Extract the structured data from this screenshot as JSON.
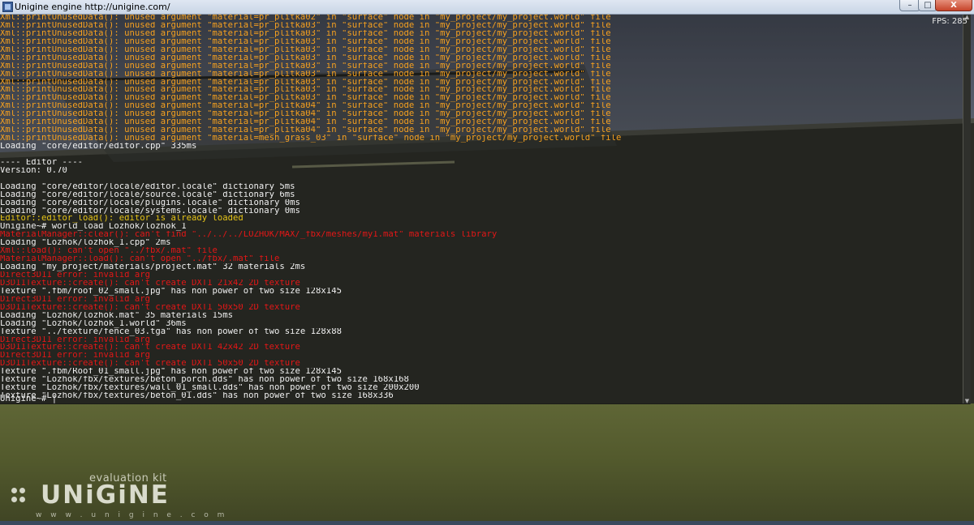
{
  "window": {
    "title": "Unigine engine http://unigine.com/",
    "minimize_label": "–",
    "maximize_label": "□",
    "close_label": "X",
    "fps_label": "FPS: 285"
  },
  "console": {
    "lines": [
      {
        "text": "Xml::printUnusedData(): unused argument \"material=pr_plitka02\" in \"surface\" node in \"my_project/my_project.world\" file",
        "color": "orange"
      },
      {
        "text": "Xml::printUnusedData(): unused argument \"material=pr_plitka03\" in \"surface\" node in \"my_project/my_project.world\" file",
        "color": "orange"
      },
      {
        "text": "Xml::printUnusedData(): unused argument \"material=pr_plitka03\" in \"surface\" node in \"my_project/my_project.world\" file",
        "color": "orange"
      },
      {
        "text": "Xml::printUnusedData(): unused argument \"material=pr_plitka03\" in \"surface\" node in \"my_project/my_project.world\" file",
        "color": "orange"
      },
      {
        "text": "Xml::printUnusedData(): unused argument \"material=pr_plitka03\" in \"surface\" node in \"my_project/my_project.world\" file",
        "color": "orange"
      },
      {
        "text": "Xml::printUnusedData(): unused argument \"material=pr_plitka03\" in \"surface\" node in \"my_project/my_project.world\" file",
        "color": "orange"
      },
      {
        "text": "Xml::printUnusedData(): unused argument \"material=pr_plitka03\" in \"surface\" node in \"my_project/my_project.world\" file",
        "color": "orange"
      },
      {
        "text": "Xml::printUnusedData(): unused argument \"material=pr_plitka03\" in \"surface\" node in \"my_project/my_project.world\" file",
        "color": "orange"
      },
      {
        "text": "Xml::printUnusedData(): unused argument \"material=pr_plitka03\" in \"surface\" node in \"my_project/my_project.world\" file",
        "color": "orange"
      },
      {
        "text": "Xml::printUnusedData(): unused argument \"material=pr_plitka03\" in \"surface\" node in \"my_project/my_project.world\" file",
        "color": "orange"
      },
      {
        "text": "Xml::printUnusedData(): unused argument \"material=pr_plitka03\" in \"surface\" node in \"my_project/my_project.world\" file",
        "color": "orange"
      },
      {
        "text": "Xml::printUnusedData(): unused argument \"material=pr_plitka04\" in \"surface\" node in \"my_project/my_project.world\" file",
        "color": "orange"
      },
      {
        "text": "Xml::printUnusedData(): unused argument \"material=pr_plitka04\" in \"surface\" node in \"my_project/my_project.world\" file",
        "color": "orange"
      },
      {
        "text": "Xml::printUnusedData(): unused argument \"material=pr_plitka04\" in \"surface\" node in \"my_project/my_project.world\" file",
        "color": "orange"
      },
      {
        "text": "Xml::printUnusedData(): unused argument \"material=pr_plitka04\" in \"surface\" node in \"my_project/my_project.world\" file",
        "color": "orange"
      },
      {
        "text": "Xml::printUnusedData(): unused argument \"material=mesh_grass_03\" in \"surface\" node in \"my_project/my_project.world\" file",
        "color": "orange"
      },
      {
        "text": "Loading \"core/editor/editor.cpp\" 335ms",
        "color": "white"
      },
      {
        "text": "",
        "color": "white"
      },
      {
        "text": "---- Editor ----",
        "color": "white"
      },
      {
        "text": "Version: 0.70",
        "color": "white"
      },
      {
        "text": "",
        "color": "white"
      },
      {
        "text": "Loading \"core/editor/locale/editor.locale\" dictionary 5ms",
        "color": "white"
      },
      {
        "text": "Loading \"core/editor/locale/source.locale\" dictionary 6ms",
        "color": "white"
      },
      {
        "text": "Loading \"core/editor/locale/plugins.locale\" dictionary 0ms",
        "color": "white"
      },
      {
        "text": "Loading \"core/editor/locale/systems.locale\" dictionary 0ms",
        "color": "white"
      },
      {
        "text": "Editor::editor_load(): editor is already loaded",
        "color": "yellow"
      },
      {
        "text": "Unigine~# world_load Lozhok/lozhok_1",
        "color": "white"
      },
      {
        "text": "MaterialManager::clear(): can't find \"../../../LOZHOK/MAX/_fbx/meshes/my1.mat\" materials library",
        "color": "red"
      },
      {
        "text": "Loading \"Lozhok/lozhok_1.cpp\" 2ms",
        "color": "white"
      },
      {
        "text": "Xml::load(): can't open \"../fbx/.mat\" file",
        "color": "red"
      },
      {
        "text": "MaterialManager::load(): can't open \"../fbx/.mat\" file",
        "color": "red"
      },
      {
        "text": "Loading \"my_project/materials/project.mat\" 32 materials 2ms",
        "color": "white"
      },
      {
        "text": "Direct3D11 error: invalid arg",
        "color": "red"
      },
      {
        "text": "D3D11Texture::create(): can't create DXT1 21x42 2D texture",
        "color": "red"
      },
      {
        "text": "Texture \".fbm/roof_02_small.jpg\" has non power of two size 128x145",
        "color": "white"
      },
      {
        "text": "Direct3D11 error: invalid arg",
        "color": "red"
      },
      {
        "text": "D3D11Texture::create(): can't create DXT1 50x50 2D texture",
        "color": "red"
      },
      {
        "text": "Loading \"Lozhok/lozhok.mat\" 35 materials 15ms",
        "color": "white"
      },
      {
        "text": "Loading \"Lozhok/lozhok_1.world\" 36ms",
        "color": "white"
      },
      {
        "text": "Texture \"../texture/fence_03.tga\" has non power of two size 128x88",
        "color": "white"
      },
      {
        "text": "Direct3D11 error: invalid arg",
        "color": "red"
      },
      {
        "text": "D3D11Texture::create(): can't create DXT1 42x42 2D texture",
        "color": "red"
      },
      {
        "text": "Direct3D11 error: invalid arg",
        "color": "red"
      },
      {
        "text": "D3D11Texture::create(): can't create DXT1 50x50 2D texture",
        "color": "red"
      },
      {
        "text": "Texture \".fbm/Roof_01_small.jpg\" has non power of two size 128x145",
        "color": "white"
      },
      {
        "text": "Texture \"Lozhok/fbx/textures/beton_porch.dds\" has non power of two size 168x168",
        "color": "white"
      },
      {
        "text": "Texture \"Lozhok/fbx/textures/wall_01_small.dds\" has non power of two size 200x200",
        "color": "white"
      },
      {
        "text": "Texture \"Lozhok/fbx/textures/beton_01.dds\" has non power of two size 168x336",
        "color": "white"
      }
    ],
    "prompt": "Unigine~# ",
    "caret": "|"
  },
  "logo": {
    "tagline": "evaluation kit",
    "wordmark": "UNiGiNE",
    "url": "w w w . u n i g i n e . c o m"
  },
  "colors": {
    "orange": "#f5a01f",
    "white": "#f0f0f0",
    "red": "#e21717",
    "yellow": "#e6c417"
  }
}
